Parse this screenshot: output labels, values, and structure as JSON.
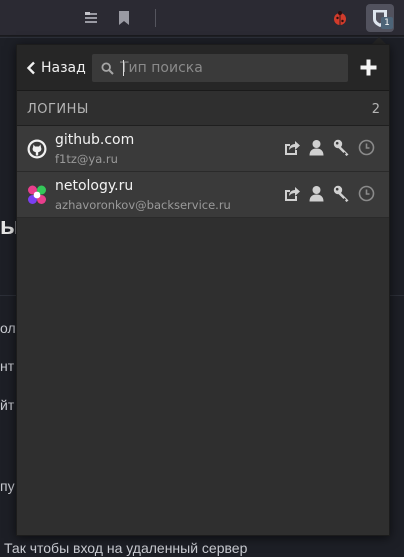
{
  "popup": {
    "back_label": "Назад",
    "search": {
      "placeholder": "Тип поиска",
      "value": ""
    },
    "section": {
      "title": "ЛОГИНЫ",
      "count": "2"
    },
    "logins": [
      {
        "title": "github.com",
        "username": "f1tz@ya.ru",
        "favicon": "github-icon"
      },
      {
        "title": "netology.ru",
        "username": "azhavoronkov@backservice.ru",
        "favicon": "netology-logo-icon"
      }
    ]
  },
  "browser": {
    "extension_badge": "1"
  },
  "background_page": {
    "fragments": [
      "ы",
      "ол",
      "нт",
      "йт",
      "пу",
      "Так чтобы вход на удаленный сервер"
    ]
  },
  "colors": {
    "popup_bg": "#2f2f2f",
    "row_bg": "#3a3a3a",
    "header_bg": "#262626",
    "text": "#f2f2f2",
    "muted": "#9a9a9a"
  }
}
